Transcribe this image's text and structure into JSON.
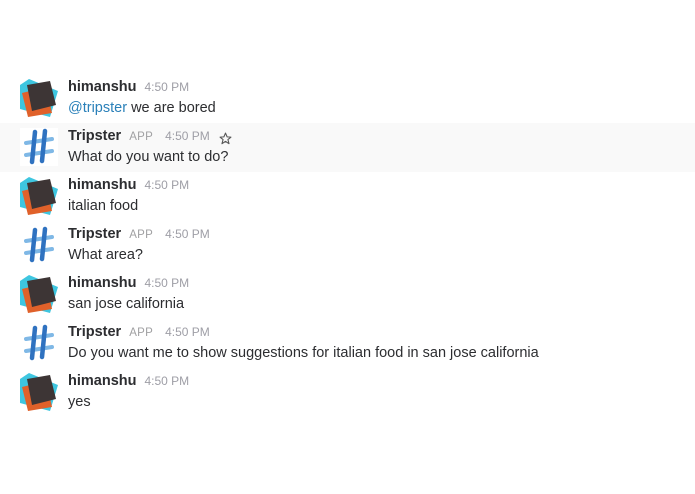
{
  "channel": {
    "messages": [
      {
        "author": "himanshu",
        "time": "4:50 PM",
        "mention": "@tripster",
        "text": " we are bored",
        "avatar": "avatar-himanshu"
      },
      {
        "author": "Tripster",
        "badge": "APP",
        "time": "4:50 PM",
        "text": "What do you want to do?",
        "avatar": "avatar-tripster",
        "star_icon": "star-outline-icon"
      },
      {
        "author": "himanshu",
        "time": "4:50 PM",
        "text": "italian food",
        "avatar": "avatar-himanshu"
      },
      {
        "author": "Tripster",
        "badge": "APP",
        "time": "4:50 PM",
        "text": "What area?",
        "avatar": "avatar-tripster"
      },
      {
        "author": "himanshu",
        "time": "4:50 PM",
        "text": "san jose california",
        "avatar": "avatar-himanshu"
      },
      {
        "author": "Tripster",
        "badge": "APP",
        "time": "4:50 PM",
        "text": "Do you want me to show suggestions for italian food in san jose california",
        "avatar": "avatar-tripster"
      },
      {
        "author": "himanshu",
        "time": "4:50 PM",
        "text": "yes",
        "avatar": "avatar-himanshu"
      }
    ]
  },
  "colors": {
    "mention": "#2a80b9",
    "hover_row": "#f9f9f9",
    "timestamp": "#9e9ea6"
  }
}
